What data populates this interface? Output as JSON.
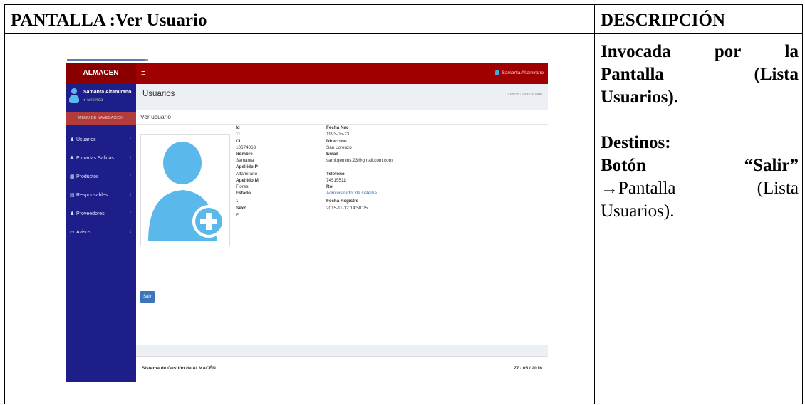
{
  "table": {
    "left_header": "PANTALLA :Ver Usuario",
    "right_header": "DESCRIPCIÓN",
    "desc": {
      "invoked_words": [
        "Invocada",
        "por",
        "la"
      ],
      "pantalla_words": [
        "Pantalla",
        "(Lista"
      ],
      "usuarios_bold": "Usuarios).",
      "destinos": "Destinos:",
      "boton_words": [
        "Botón",
        "“Salir”"
      ],
      "arrow_line": [
        "→Pantalla",
        "(Lista"
      ],
      "usuarios_plain": "Usuarios)."
    }
  },
  "screenshot": {
    "brand": "ALMACEN",
    "toggle": "≡",
    "nav_user": "Samanta Altamirano",
    "user_name": "Samanta Altamirano",
    "user_status": "● En línea",
    "menu_header": "MENU DE NAVEGACION",
    "menu_items": [
      {
        "glyph": "♟",
        "label": "Usuarios"
      },
      {
        "glyph": "✱",
        "label": "Entradas Salidas"
      },
      {
        "glyph": "▦",
        "label": "Productos"
      },
      {
        "glyph": "▤",
        "label": "Responsables"
      },
      {
        "glyph": "♟",
        "label": "Proveedores"
      },
      {
        "glyph": "▭",
        "label": "Avisos"
      }
    ],
    "chevron": "‹",
    "page_title": "Usuarios",
    "breadcrumb": "⌂ Inicio / Ver usuario",
    "box_title": "Ver usuario",
    "fields_left": [
      {
        "label": "Id",
        "value": "11"
      },
      {
        "label": "CI",
        "value": "10674063"
      },
      {
        "label": "Nombre",
        "value": "Samanta"
      },
      {
        "label": "Apellido P",
        "value": "Altamirano"
      },
      {
        "label": "Apellido M",
        "value": "Flores"
      },
      {
        "label": "Estado",
        "value": "1"
      },
      {
        "label": "Sexo",
        "value": "F"
      }
    ],
    "fields_right": [
      {
        "label": "Fecha Nac",
        "value": "1993-05-23"
      },
      {
        "label": "Direccion",
        "value": "San Lorenzo"
      },
      {
        "label": "Email",
        "value": "sami.gemins.23@gmail.com.com"
      },
      {
        "label": "Telefono",
        "value": "74515511"
      },
      {
        "label": "Rol",
        "value": "Administrador de sistema"
      },
      {
        "label": "Fecha Registro",
        "value": "2015-11-12 14:50:05"
      }
    ],
    "salir_label": "Salir",
    "footer_left": "Sistema de Gestión de ALMACÉN",
    "footer_right": "27 / 05 / 2016",
    "colors": {
      "navbar": "#a00000",
      "sidebar": "#1e1e8a",
      "avatar": "#5bb8ea",
      "button": "#3c75b9"
    }
  }
}
